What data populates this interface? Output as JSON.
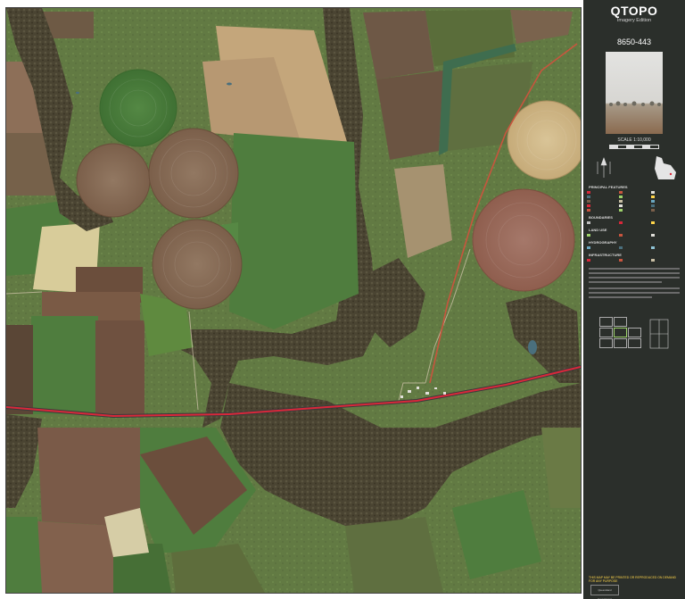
{
  "map": {
    "brand": "QTOPO",
    "edition": "Imagery Edition",
    "sheet_number": "8650-443",
    "scale": "SCALE 1:10,000",
    "colors": {
      "pasture": "#556c3a",
      "riparian": "#3e3a2a",
      "field_green": "#4f7d3e",
      "field_dark_green": "#3f6a2f",
      "field_brown": "#7a5c43",
      "field_tan": "#b8a27a",
      "field_pale": "#d8cc9a",
      "pivot_green": "#4d7d3b",
      "pivot_brown": "#8a6c55",
      "pivot_tan": "#cdb585",
      "pivot_red": "#9b6a5a",
      "highway": "#d8283a",
      "water": "#4a6f7d",
      "sidebar_bg": "#2b2f2b"
    }
  },
  "sidebar": {
    "legend_headings": [
      "PRINCIPAL FEATURES",
      "BOUNDARIES",
      "LAND USE",
      "HYDROGRAPHY",
      "INFRASTRUCTURE"
    ],
    "footer_warning": "THIS MAP MAY BE PRINTED OR REPRODUCED ON DEMAND FOR ANY PURPOSE",
    "agency": "Queensland Government"
  }
}
